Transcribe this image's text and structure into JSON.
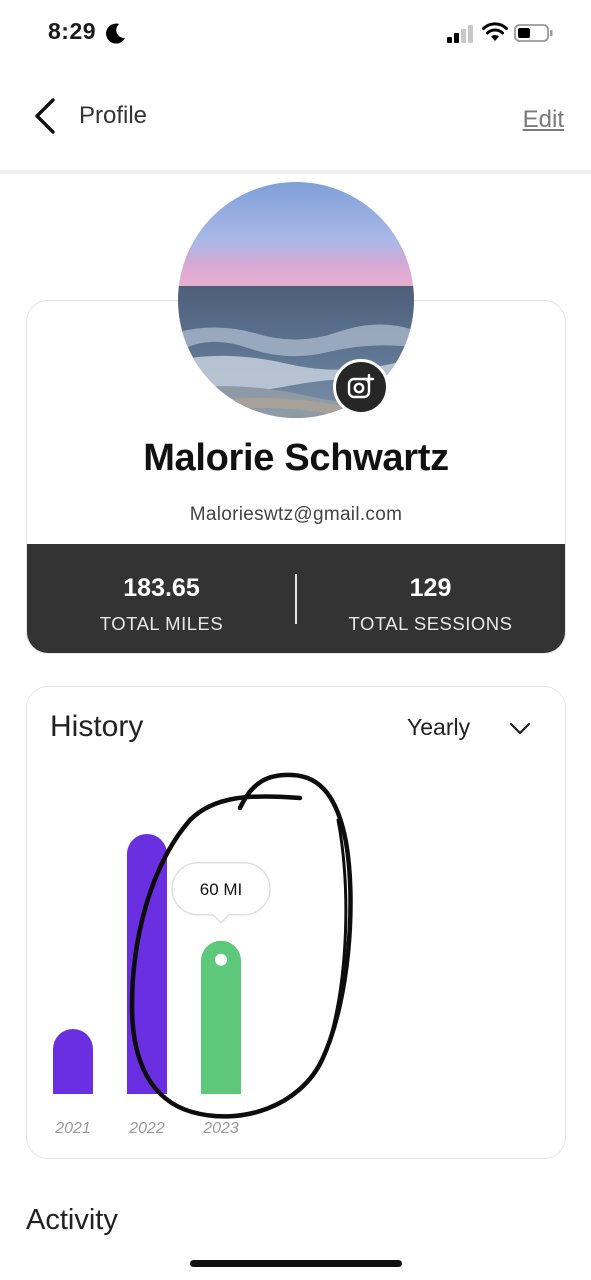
{
  "status_bar": {
    "time": "8:29",
    "icons": [
      "moon-icon",
      "cellular-signal-icon",
      "wifi-icon",
      "battery-icon"
    ]
  },
  "nav": {
    "back_icon": "chevron-left-icon",
    "title": "Profile",
    "edit_label": "Edit"
  },
  "profile": {
    "avatar_icon": "profile-photo",
    "camera_icon": "camera-plus-icon",
    "name": "Malorie Schwartz",
    "email": "Malorieswtz@gmail.com",
    "stats": [
      {
        "value": "183.65",
        "label": "TOTAL MILES"
      },
      {
        "value": "129",
        "label": "TOTAL SESSIONS"
      }
    ]
  },
  "history": {
    "title": "History",
    "period": "Yearly",
    "period_icon": "chevron-down-icon"
  },
  "chart_data": {
    "type": "bar",
    "categories": [
      "2021",
      "2022",
      "2023"
    ],
    "values": [
      14,
      56,
      33
    ],
    "colors": [
      "#6a2fe0",
      "#6a2fe0",
      "#5ec87a"
    ],
    "selected_index": 2,
    "tooltip": "60 MI",
    "grid": false,
    "annotation": "hand-drawn circle around 2023 bar"
  },
  "activity": {
    "title": "Activity"
  },
  "colors": {
    "accent_purple": "#6a2fe0",
    "accent_green": "#5ec87a",
    "stats_bar": "#333333",
    "card_border": "#e6e6e6"
  }
}
